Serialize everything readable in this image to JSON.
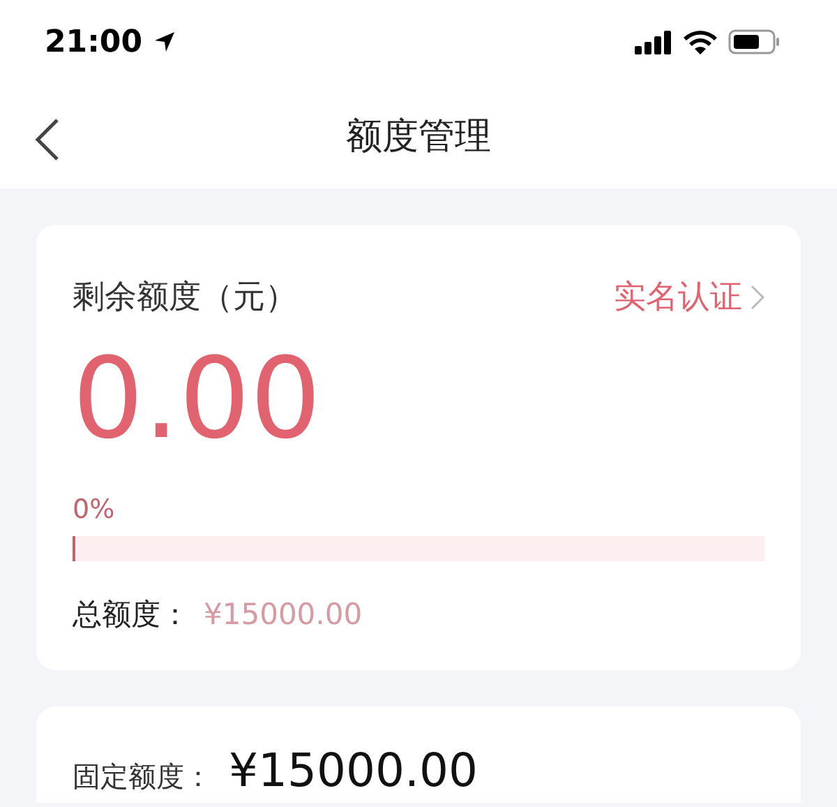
{
  "status_bar": {
    "time": "21:00"
  },
  "nav": {
    "title": "额度管理"
  },
  "balance_card": {
    "label": "剩余额度（元）",
    "link": "实名认证",
    "amount": "0.00",
    "percent": "0%",
    "level": 0,
    "total_label": "总额度：",
    "total_value": "¥15000.00"
  },
  "fixed_card": {
    "label": "固定额度：",
    "value": "¥15000.00"
  }
}
